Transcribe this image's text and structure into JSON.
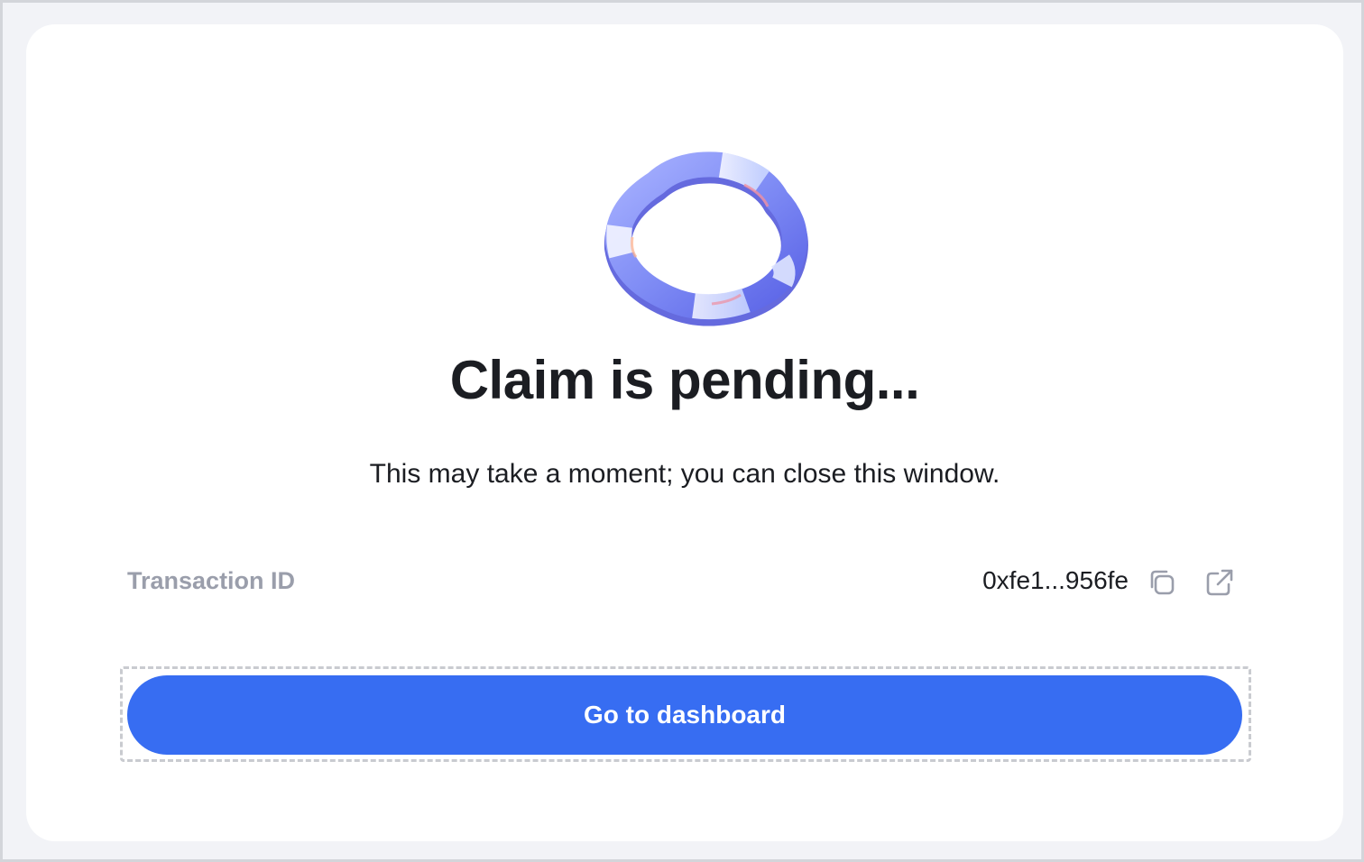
{
  "status": {
    "title": "Claim is pending...",
    "subtitle": "This may take a moment; you can close this window."
  },
  "transaction": {
    "label": "Transaction ID",
    "value": "0xfe1...956fe",
    "copy_icon": "copy-icon",
    "external_icon": "external-link-icon"
  },
  "actions": {
    "primary_label": "Go to dashboard"
  },
  "colors": {
    "primary": "#376df2",
    "text": "#1b1d22",
    "muted": "#9a9eab",
    "ring": "#6f7cf2"
  }
}
